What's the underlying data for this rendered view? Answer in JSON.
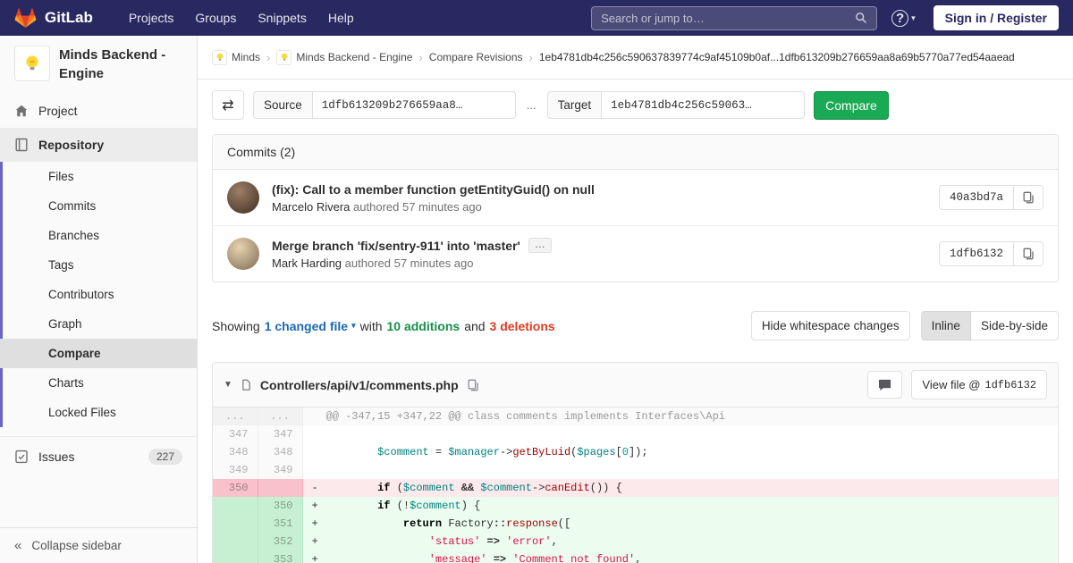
{
  "navbar": {
    "brand": "GitLab",
    "menu": [
      "Projects",
      "Groups",
      "Snippets",
      "Help"
    ],
    "search_placeholder": "Search or jump to…",
    "sign_in": "Sign in / Register"
  },
  "sidebar": {
    "project_name": "Minds Backend - Engine",
    "top_items": [
      "Project",
      "Repository"
    ],
    "repo_subitems": [
      "Files",
      "Commits",
      "Branches",
      "Tags",
      "Contributors",
      "Graph",
      "Compare",
      "Charts",
      "Locked Files"
    ],
    "active_subitem": "Compare",
    "issues_label": "Issues",
    "issues_count": "227",
    "collapse_label": "Collapse sidebar"
  },
  "breadcrumb": {
    "group": "Minds",
    "project": "Minds Backend - Engine",
    "page": "Compare Revisions",
    "sha_range": "1eb4781db4c256c590637839774c9af45109b0af...1dfb613209b276659aa8a69b5770a77ed54aaead"
  },
  "compare_form": {
    "source_label": "Source",
    "source_value": "1dfb613209b276659aa8…",
    "separator": "...",
    "target_label": "Target",
    "target_value": "1eb4781db4c256c59063…",
    "compare_button": "Compare"
  },
  "commits": {
    "header": "Commits (2)",
    "items": [
      {
        "title": "(fix): Call to a member function getEntityGuid() on null",
        "author": "Marcelo Rivera",
        "meta": "authored 57 minutes ago",
        "sha": "40a3bd7a"
      },
      {
        "title": "Merge branch 'fix/sentry-911' into 'master'",
        "toggle": "…",
        "author": "Mark Harding",
        "meta": "authored 57 minutes ago",
        "sha": "1dfb6132"
      }
    ]
  },
  "summary": {
    "showing": "Showing",
    "changed_files": "1 changed file",
    "with_text": "with",
    "additions": "10 additions",
    "and_text": "and",
    "deletions": "3 deletions",
    "whitespace_button": "Hide whitespace changes",
    "inline_button": "Inline",
    "side_by_side_button": "Side-by-side"
  },
  "diff": {
    "file_path": "Controllers/api/v1/comments.php",
    "view_file_label": "View file @",
    "view_file_sha": "1dfb6132",
    "rows": [
      {
        "type": "match",
        "old": "...",
        "new": "...",
        "marker": "",
        "tokens": [
          {
            "t": "@@ -347,15 +347,22 @@ class comments implements Interfaces\\Api",
            "c": "match"
          }
        ]
      },
      {
        "type": "context",
        "old": "347",
        "new": "347",
        "marker": " ",
        "tokens": []
      },
      {
        "type": "context",
        "old": "348",
        "new": "348",
        "marker": " ",
        "tokens": [
          {
            "t": "        ",
            "c": ""
          },
          {
            "t": "$comment",
            "c": "nv"
          },
          {
            "t": " = ",
            "c": ""
          },
          {
            "t": "$manager",
            "c": "nv"
          },
          {
            "t": "->",
            "c": ""
          },
          {
            "t": "getByLuid",
            "c": "nf"
          },
          {
            "t": "(",
            "c": ""
          },
          {
            "t": "$pages",
            "c": "nv"
          },
          {
            "t": "[",
            "c": ""
          },
          {
            "t": "0",
            "c": "mi"
          },
          {
            "t": "]);",
            "c": ""
          }
        ]
      },
      {
        "type": "context",
        "old": "349",
        "new": "349",
        "marker": " ",
        "tokens": []
      },
      {
        "type": "removed",
        "old": "350",
        "new": "",
        "marker": "-",
        "tokens": [
          {
            "t": "        ",
            "c": ""
          },
          {
            "t": "if",
            "c": "k"
          },
          {
            "t": " (",
            "c": ""
          },
          {
            "t": "$comment",
            "c": "nv"
          },
          {
            "t": " ",
            "c": ""
          },
          {
            "t": "&&",
            "c": "o"
          },
          {
            "t": " ",
            "c": ""
          },
          {
            "t": "$comment",
            "c": "nv"
          },
          {
            "t": "->",
            "c": ""
          },
          {
            "t": "canEdit",
            "c": "nf"
          },
          {
            "t": "()) {",
            "c": ""
          }
        ]
      },
      {
        "type": "added",
        "old": "",
        "new": "350",
        "marker": "+",
        "tokens": [
          {
            "t": "        ",
            "c": ""
          },
          {
            "t": "if",
            "c": "k"
          },
          {
            "t": " (!",
            "c": ""
          },
          {
            "t": "$comment",
            "c": "nv"
          },
          {
            "t": ") {",
            "c": ""
          }
        ]
      },
      {
        "type": "added",
        "old": "",
        "new": "351",
        "marker": "+",
        "tokens": [
          {
            "t": "            ",
            "c": ""
          },
          {
            "t": "return",
            "c": "k"
          },
          {
            "t": " Factory",
            "c": ""
          },
          {
            "t": "::",
            "c": "o"
          },
          {
            "t": "response",
            "c": "nf"
          },
          {
            "t": "([",
            "c": ""
          }
        ]
      },
      {
        "type": "added",
        "old": "",
        "new": "352",
        "marker": "+",
        "tokens": [
          {
            "t": "                ",
            "c": ""
          },
          {
            "t": "'status'",
            "c": "s"
          },
          {
            "t": " ",
            "c": ""
          },
          {
            "t": "=>",
            "c": "o"
          },
          {
            "t": " ",
            "c": ""
          },
          {
            "t": "'error'",
            "c": "s"
          },
          {
            "t": ",",
            "c": ""
          }
        ]
      },
      {
        "type": "added",
        "old": "",
        "new": "353",
        "marker": "+",
        "tokens": [
          {
            "t": "                ",
            "c": ""
          },
          {
            "t": "'message'",
            "c": "s"
          },
          {
            "t": " ",
            "c": ""
          },
          {
            "t": "=>",
            "c": "o"
          },
          {
            "t": " ",
            "c": ""
          },
          {
            "t": "'Comment not found'",
            "c": "s"
          },
          {
            "t": ",",
            "c": ""
          }
        ]
      }
    ]
  },
  "colors": {
    "navbar_bg": "#292961",
    "accent_purple": "#6666c4",
    "button_green": "#1aaa55",
    "link_blue": "#1b69b6",
    "addition_green": "#168f48",
    "deletion_red": "#db3b21",
    "added_line_bg": "#ecfdf0",
    "removed_line_bg": "#fbe9eb"
  }
}
